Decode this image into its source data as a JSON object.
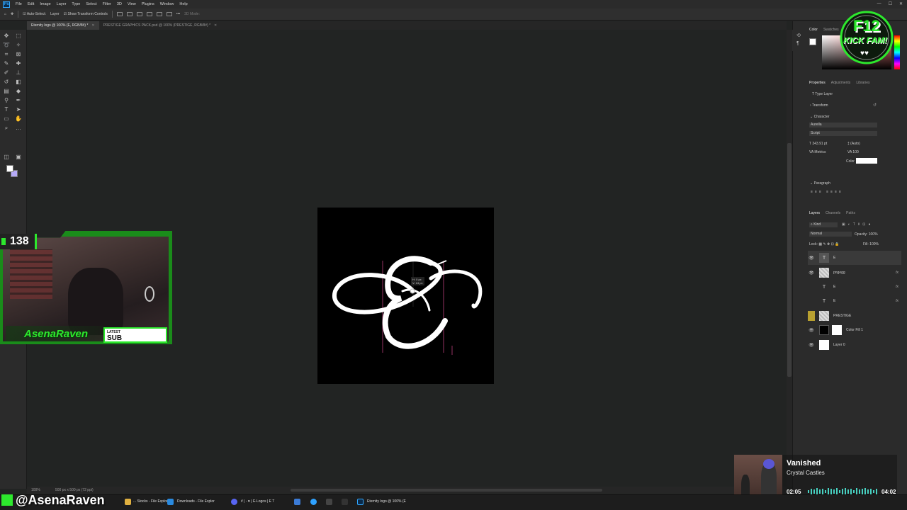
{
  "menubar": {
    "items": [
      "File",
      "Edit",
      "Image",
      "Layer",
      "Type",
      "Select",
      "Filter",
      "3D",
      "View",
      "Plugins",
      "Window",
      "Help"
    ]
  },
  "options": {
    "auto_select": "Auto-Select:",
    "layer_select": "Layer",
    "show_transform": "Show Transform Controls",
    "mode_3d": "3D Mode:"
  },
  "tabs": [
    {
      "label": "Eternity logo @ 100% (E, RGB/8#) *",
      "active": true
    },
    {
      "label": "PRESTIGE GRAPHICS PACK.psd @ 100% (PRESTIGE, RGB/8#) *",
      "active": false
    }
  ],
  "status": {
    "zoom": "100%",
    "dims": "500 px x 500 px (72 ppi)"
  },
  "right": {
    "top_tabs": [
      "Color",
      "Swatches"
    ],
    "prop_tabs": [
      "Properties",
      "Adjustments",
      "Libraries"
    ],
    "type_layer": "Type Layer",
    "transform": "Transform",
    "character": "Character",
    "font": "Aurella",
    "font_style": "Script",
    "font_size": "343.91 pt",
    "leading": "(Auto)",
    "kerning": "Metrics",
    "tracking": "100",
    "color_label": "Color",
    "paragraph": "Paragraph",
    "layer_tabs": [
      "Layers",
      "Channels",
      "Paths"
    ],
    "filter_kind": "Kind",
    "blend_mode": "Normal",
    "opacity_label": "Opacity:",
    "opacity": "100%",
    "lock_label": "Lock:",
    "fill_label": "Fill:",
    "fill": "100%"
  },
  "layers": [
    {
      "name": "E",
      "thumb": "T",
      "type": "text",
      "selected": true,
      "fx": "",
      "visible": true
    },
    {
      "name": "pngegg",
      "thumb": "",
      "type": "image",
      "selected": false,
      "fx": "fx",
      "visible": true
    },
    {
      "name": "E",
      "thumb": "T",
      "type": "text",
      "selected": false,
      "fx": "fx",
      "visible": false
    },
    {
      "name": "E",
      "thumb": "T",
      "type": "text",
      "selected": false,
      "fx": "fx",
      "visible": false
    },
    {
      "name": "PRESTIGE",
      "thumb": "",
      "type": "folder",
      "selected": false,
      "fx": "",
      "visible": false
    },
    {
      "name": "Color Fill 1",
      "thumb": "",
      "type": "fill",
      "selected": false,
      "fx": "",
      "visible": true
    },
    {
      "name": "Layer 0",
      "thumb": "",
      "type": "white",
      "selected": false,
      "fx": "",
      "visible": true
    }
  ],
  "canvas": {
    "tooltip_line1": "H: 0 px",
    "tooltip_line2": "V: 24 px"
  },
  "overlay": {
    "sub_count": "138",
    "latest_name": "AsenaRaven",
    "latest_label1": "LATEST",
    "latest_label2": "SUB",
    "badge_line1": "F12",
    "badge_line2": "KICK FAM!",
    "handle": "@AsenaRaven"
  },
  "music": {
    "song": "Vanished",
    "artist": "Crystal Castles",
    "elapsed": "02:05",
    "total": "04:02"
  },
  "taskbar": {
    "items": [
      "... Stocks - File Explorer",
      "Downloads - File Explor",
      "# | - ♥ | E-Logos | E T",
      "Eternity logo @ 100% (E"
    ]
  },
  "colors": {
    "accent_green": "#2de82d",
    "ps_blue": "#31a8ff",
    "bg_color": "#b6aaf7"
  }
}
